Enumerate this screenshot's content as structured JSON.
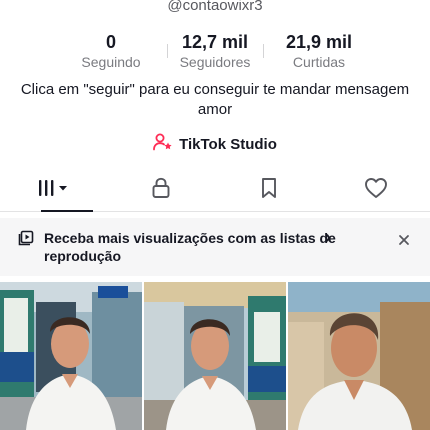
{
  "profile": {
    "handle": "@contaowixr3",
    "stats": [
      {
        "value": "0",
        "label": "Seguindo"
      },
      {
        "value": "12,7 mil",
        "label": "Seguidores"
      },
      {
        "value": "21,9 mil",
        "label": "Curtidas"
      }
    ],
    "bio": "Clica em \"seguir\" para eu conseguir te mandar mensagem amor",
    "studio_label": "TikTok Studio"
  },
  "tabs": [
    {
      "icon": "grid-icon",
      "active": true
    },
    {
      "icon": "lock-icon",
      "active": false
    },
    {
      "icon": "bookmark-icon",
      "active": false
    },
    {
      "icon": "heart-icon",
      "active": false
    }
  ],
  "banner": {
    "text": "Receba mais visualizações com as listas de reprodução",
    "chevron": "›",
    "close": "×"
  },
  "colors": {
    "accent": "#fe2c55",
    "text": "#161823",
    "muted": "#7a7b80",
    "banner_bg": "#f6f6f7"
  }
}
